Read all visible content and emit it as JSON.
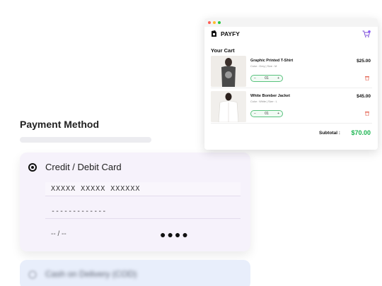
{
  "payment": {
    "title": "Payment Method",
    "card_option": {
      "label": "Credit / Debit Card",
      "number_placeholder": "XXXXX XXXXX XXXXXX",
      "name_placeholder": "-------------",
      "expiry_placeholder": "-- / --",
      "cvv_placeholder": "●●●●"
    },
    "cod_option": {
      "label": "Cash on Delivery (COD)"
    }
  },
  "cart": {
    "brand": "PAYFY",
    "title": "Your Cart",
    "cart_badge_color": "#8b5cf6",
    "accent_color": "#1cb551",
    "items": [
      {
        "name": "Graphic Printed T-Shirt",
        "meta": "Color : Grey   |   Size : M",
        "price": "$25.00",
        "qty": "01",
        "minus": "−",
        "plus": "+"
      },
      {
        "name": "White Bomber Jacket",
        "meta": "Color : White   |   Size : L",
        "price": "$45.00",
        "qty": "01",
        "minus": "−",
        "plus": "+"
      }
    ],
    "subtotal_label": "Subtotal :",
    "subtotal_value": "$70.00"
  }
}
